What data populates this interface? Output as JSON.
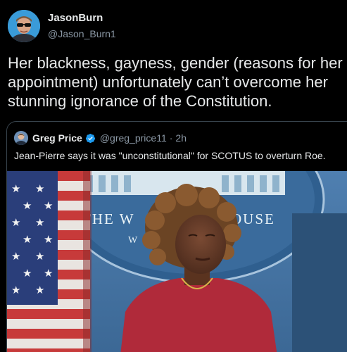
{
  "author": {
    "display_name": "JasonBurn",
    "handle": "@Jason_Burn1",
    "avatar_icon": "profile-photo-icon"
  },
  "tweet": {
    "text": "Her blackness, gayness, gender (reasons for her\nappointment) unfortunately can’t overcome her\nstunning ignorance of the Constitution."
  },
  "quoted_tweet": {
    "display_name": "Greg Price",
    "handle": "@greg_price11",
    "separator": "·",
    "time": "2h",
    "verified_icon": "verified-badge-icon",
    "text": "Jean-Pierre says it was \"unconstitutional\" for SCOTUS to overturn Roe.",
    "media": {
      "backdrop_text_left": "THE W",
      "backdrop_text_right": "OUSE",
      "backdrop_fragment": "W"
    }
  },
  "colors": {
    "background": "#000000",
    "text_primary": "#e7e9ea",
    "text_secondary": "#8b98a5",
    "card_border": "#38444d",
    "verified_blue": "#1d9bf0"
  }
}
